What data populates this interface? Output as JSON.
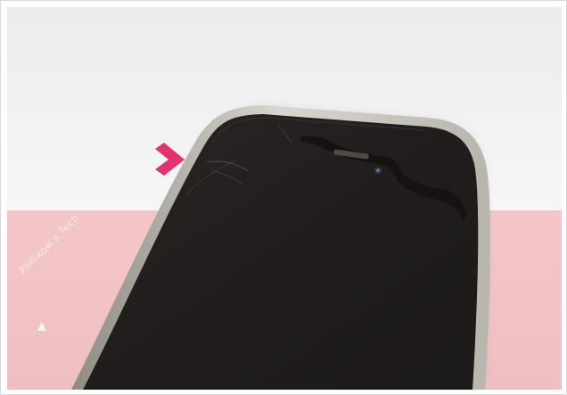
{
  "watermark": {
    "text": "Philixow’s Tech"
  },
  "colors": {
    "upper_background": "#f0f0f0",
    "lower_background": "#f2c5c6",
    "arrow": "#e0336f",
    "phone_screen": "#231f1e",
    "phone_frame": "#c8c7bf"
  },
  "icons": {
    "indicator": "chevron-right-icon",
    "watermark_logo": "logo-icon"
  }
}
